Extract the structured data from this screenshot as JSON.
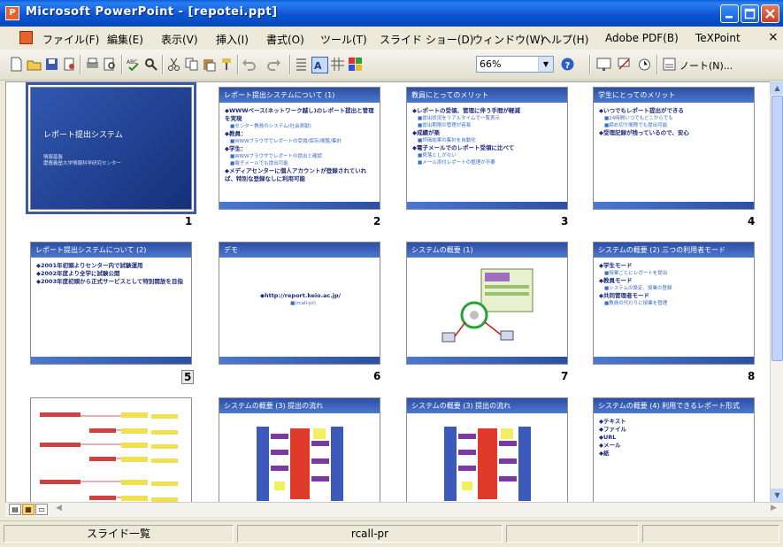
{
  "window": {
    "title": "Microsoft PowerPoint - [repotei.ppt]",
    "app_icon": "powerpoint-icon"
  },
  "menu": [
    "ファイル(F)",
    "編集(E)",
    "表示(V)",
    "挿入(I)",
    "書式(O)",
    "ツール(T)",
    "スライド ショー(D)",
    "ウィンドウ(W)",
    "ヘルプ(H)",
    "Adobe PDF(B)",
    "TeXPoint"
  ],
  "menu_close": "×",
  "toolbar": {
    "zoom": "66%",
    "notes_label": "ノート(N)..."
  },
  "slides": [
    {
      "number": "1",
      "title": "レポート提出システム",
      "subtitle_lines": [
        "情報基盤",
        "慶應義塾大学情報科学研究センター"
      ],
      "type": "title"
    },
    {
      "number": "2",
      "title": "レポート提出システムについて (1)",
      "lines": [
        {
          "t": "WWWベース(ネットワーク越し)のレポート提出と管理を実現",
          "k": "b"
        },
        {
          "t": "センター教員のシステム(社会貢献)",
          "k": "s"
        },
        {
          "t": "教員：",
          "k": "b"
        },
        {
          "t": "WWWブラウザでレポートの受領/保存/閲覧/集計",
          "k": "s"
        },
        {
          "t": "学生：",
          "k": "b"
        },
        {
          "t": "WWWブラウザでレポートの提出と確認",
          "k": "s"
        },
        {
          "t": "電子メールでも提出可能",
          "k": "s"
        },
        {
          "t": "メディアセンターに個人アカウントが登録されていれば、特別な登録なしに利用可能",
          "k": "b"
        }
      ]
    },
    {
      "number": "3",
      "title": "教員にとってのメリット",
      "lines": [
        {
          "t": "レポートの受領、管理に伴う手間が軽減",
          "k": "b"
        },
        {
          "t": "提出状況をリアルタイムで一覧表示",
          "k": "s"
        },
        {
          "t": "提出期限の管理が容易",
          "k": "s"
        },
        {
          "t": "成績が楽",
          "k": "b"
        },
        {
          "t": "評価結果の集計を自動化",
          "k": "s"
        },
        {
          "t": "電子メールでのレポート受領に比べて",
          "k": "b"
        },
        {
          "t": "見落としがない",
          "k": "s"
        },
        {
          "t": "メール添付レポートの整理が不要",
          "k": "s"
        }
      ]
    },
    {
      "number": "4",
      "title": "学生にとってのメリット",
      "lines": [
        {
          "t": "いつでもレポート提出ができる",
          "k": "b"
        },
        {
          "t": "24時間いつでもどこからでも",
          "k": "s"
        },
        {
          "t": "締め切り間際でも提出可能",
          "k": "s"
        },
        {
          "t": "受理記録が残っているので、安心",
          "k": "b"
        }
      ]
    },
    {
      "number": "5",
      "title": "レポート提出システムについて (2)",
      "lines": [
        {
          "t": "2001年初頭よりセンター内で試験運用",
          "k": "b"
        },
        {
          "t": "2002年度より全学に試験公開",
          "k": "b"
        },
        {
          "t": "2003年度初頭から正式サービスとして特別開放を目指",
          "k": "b"
        }
      ]
    },
    {
      "number": "6",
      "title": "デモ",
      "lines": [
        {
          "t": "http://report.keio.ac.jp/",
          "k": "b"
        },
        {
          "t": "(rcall-pr)",
          "k": "s"
        }
      ]
    },
    {
      "number": "7",
      "title": "システムの概要 (1)",
      "lines": []
    },
    {
      "number": "8",
      "title": "システムの概要 (2) 三つの利用者モード",
      "lines": [
        {
          "t": "学生モード",
          "k": "b"
        },
        {
          "t": "授業ごとにレポートを提出",
          "k": "s"
        },
        {
          "t": "教員モード",
          "k": "b"
        },
        {
          "t": "システムの設定、授業の登録",
          "k": "s"
        },
        {
          "t": "共同管理者モード",
          "k": "b"
        },
        {
          "t": "教員の代わりに授業を管理",
          "k": "s"
        }
      ]
    },
    {
      "number": "9",
      "title": "",
      "lines": []
    },
    {
      "number": "10",
      "title": "システムの概要 (3) 提出の流れ",
      "lines": []
    },
    {
      "number": "11",
      "title": "システムの概要 (3) 提出の流れ",
      "lines": []
    },
    {
      "number": "12",
      "title": "システムの概要 (4) 利用できるレポート形式",
      "lines": [
        {
          "t": "テキスト",
          "k": "b"
        },
        {
          "t": "ファイル",
          "k": "b"
        },
        {
          "t": "URL",
          "k": "b"
        },
        {
          "t": "メール",
          "k": "b"
        },
        {
          "t": "紙",
          "k": "b"
        }
      ]
    }
  ],
  "status": {
    "view": "スライド一覧",
    "template": "rcall-pr"
  },
  "colors": {
    "title_bar": "#0B55D4",
    "slide_header": "#2C4FA4",
    "selected_outline": "#3C5AA0"
  }
}
